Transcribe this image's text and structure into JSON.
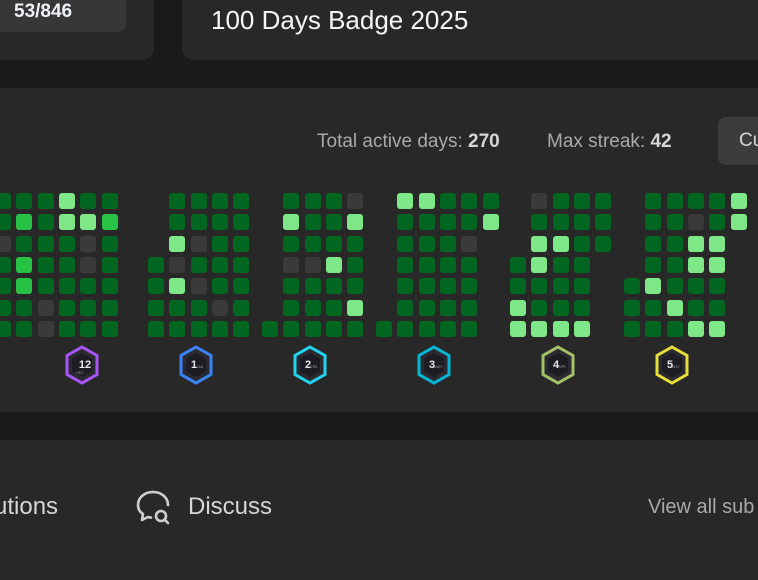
{
  "header": {
    "progress": "53/846",
    "badge_title": "100 Days Badge 2025"
  },
  "calendar": {
    "total_active_label": "Total active days:",
    "total_active_value": "270",
    "max_streak_label": "Max streak:",
    "max_streak_value": "42",
    "current_button": "Cu",
    "colors": {
      "empty": "#3a3a3a",
      "level1": "#016620",
      "level2": "#28c244",
      "level3": "#7ee787"
    },
    "months": [
      {
        "columns": [
          [
            1,
            1,
            0,
            1,
            1,
            1,
            1
          ],
          [
            1,
            2,
            1,
            2,
            2,
            1,
            1
          ],
          [
            1,
            1,
            1,
            1,
            1,
            0,
            0
          ],
          [
            3,
            3,
            1,
            1,
            1,
            1,
            1
          ],
          [
            1,
            3,
            0,
            0,
            1,
            1,
            1
          ],
          [
            1,
            2,
            1,
            1,
            1,
            1,
            1
          ]
        ]
      },
      {
        "columns": [
          [
            -1,
            -1,
            -1,
            1,
            1,
            1,
            1
          ],
          [
            1,
            1,
            3,
            0,
            3,
            1,
            1
          ],
          [
            1,
            1,
            0,
            1,
            0,
            1,
            1
          ],
          [
            1,
            1,
            1,
            1,
            1,
            0,
            1
          ],
          [
            1,
            1,
            1,
            1,
            1,
            1,
            1
          ]
        ]
      },
      {
        "columns": [
          [
            -1,
            -1,
            -1,
            -1,
            -1,
            -1,
            1
          ],
          [
            1,
            3,
            1,
            0,
            1,
            1,
            1
          ],
          [
            1,
            1,
            1,
            0,
            1,
            1,
            1
          ],
          [
            1,
            1,
            1,
            3,
            1,
            1,
            1
          ],
          [
            0,
            3,
            1,
            1,
            1,
            3,
            1
          ]
        ]
      },
      {
        "columns": [
          [
            -1,
            -1,
            -1,
            -1,
            -1,
            -1,
            1
          ],
          [
            3,
            1,
            1,
            1,
            1,
            1,
            1
          ],
          [
            3,
            1,
            1,
            1,
            1,
            1,
            1
          ],
          [
            1,
            1,
            1,
            1,
            1,
            1,
            1
          ],
          [
            1,
            1,
            0,
            1,
            1,
            1,
            1
          ],
          [
            1,
            3,
            -1,
            -1,
            -1,
            -1,
            -1
          ]
        ]
      },
      {
        "columns": [
          [
            -1,
            -1,
            -1,
            1,
            1,
            3,
            3
          ],
          [
            0,
            1,
            3,
            3,
            1,
            1,
            3
          ],
          [
            1,
            1,
            3,
            1,
            1,
            1,
            3
          ],
          [
            1,
            1,
            1,
            1,
            1,
            1,
            3
          ],
          [
            1,
            1,
            1,
            -1,
            -1,
            -1,
            -1
          ]
        ]
      },
      {
        "columns": [
          [
            -1,
            -1,
            -1,
            -1,
            1,
            1,
            1
          ],
          [
            1,
            1,
            1,
            1,
            3,
            1,
            1
          ],
          [
            1,
            1,
            1,
            1,
            1,
            3,
            1
          ],
          [
            1,
            0,
            3,
            3,
            1,
            1,
            3
          ],
          [
            1,
            1,
            3,
            3,
            1,
            1,
            3
          ],
          [
            3,
            3,
            -1,
            -1,
            -1,
            -1,
            -1
          ]
        ]
      }
    ],
    "badges": [
      {
        "text": "12",
        "sub": "DEC",
        "color": "#a855f7"
      },
      {
        "text": "1",
        "sub": "JAN",
        "color": "#3b82f6"
      },
      {
        "text": "2",
        "sub": "FEB",
        "color": "#22d3ee"
      },
      {
        "text": "3",
        "sub": "MAR",
        "color": "#06b6d4"
      },
      {
        "text": "4",
        "sub": "APR",
        "color": "#a3c166"
      },
      {
        "text": "5",
        "sub": "MAY",
        "color": "#e6dd3b"
      }
    ]
  },
  "bottom": {
    "solutions_label": "utions",
    "discuss_label": "Discuss",
    "view_all_label": "View all sub"
  }
}
